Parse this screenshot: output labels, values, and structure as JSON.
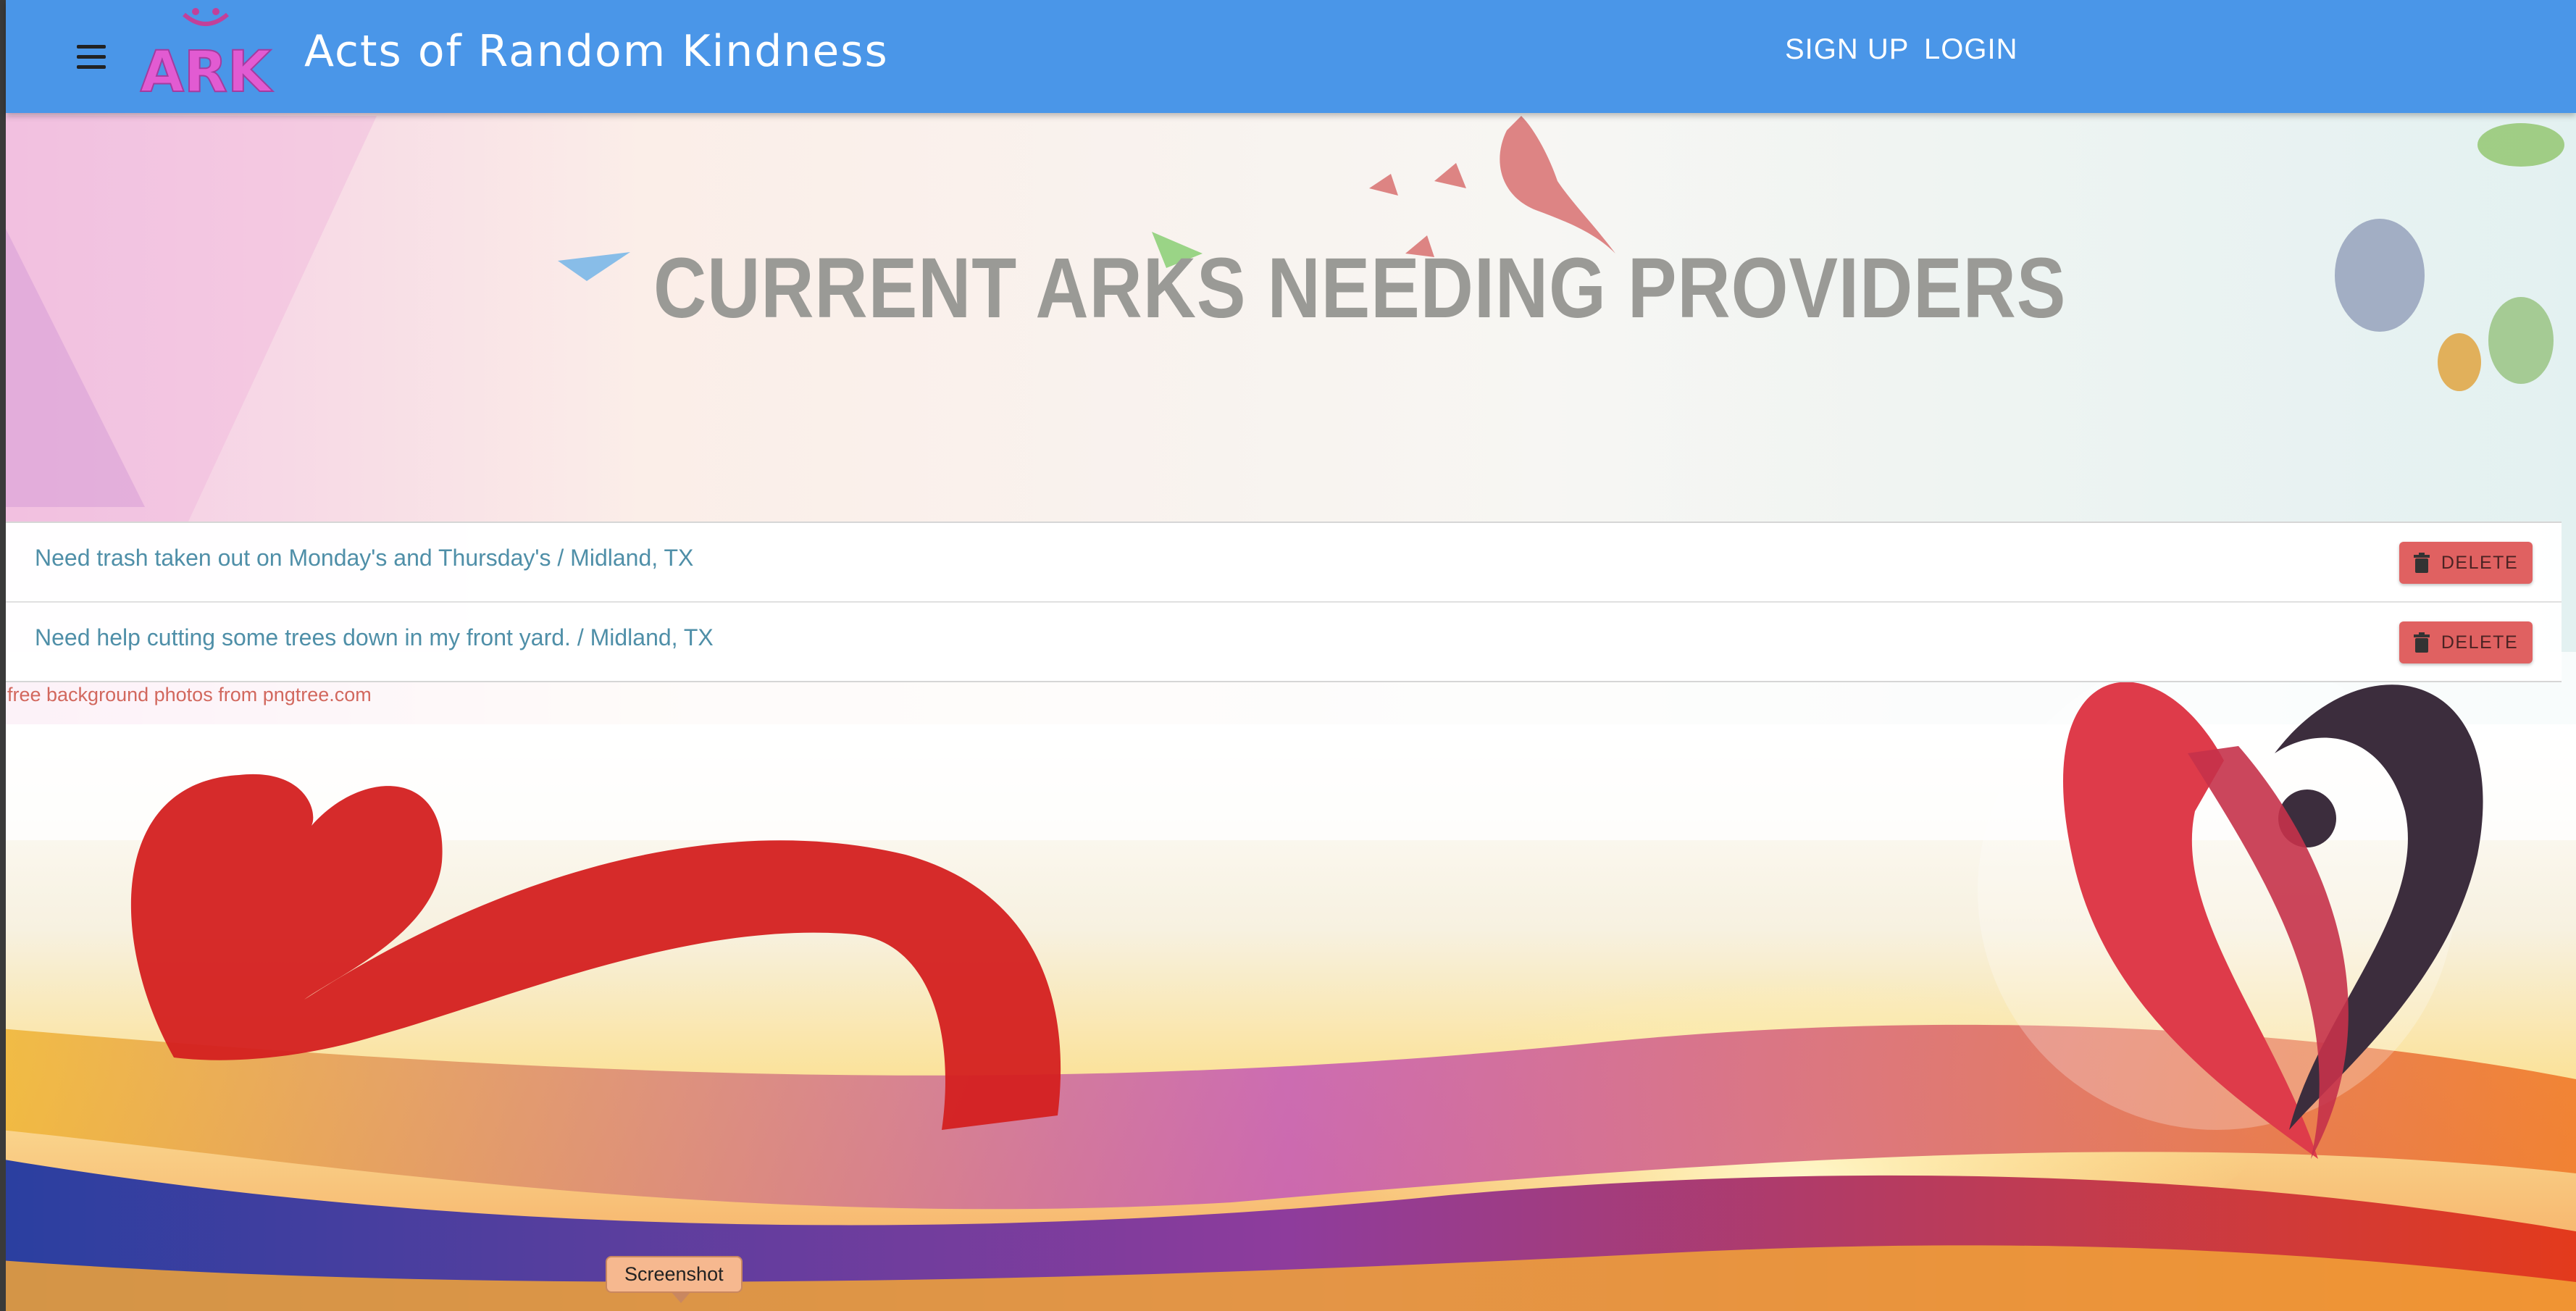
{
  "header": {
    "logo_text": "ARK",
    "title": "Acts of Random Kindness",
    "nav": {
      "signup": "SIGN UP",
      "login": "LOGIN"
    }
  },
  "main": {
    "heading": "CURRENT ARKS NEEDING PROVIDERS",
    "arks": [
      {
        "text": "Need trash taken out on Monday's and Thursday's / Midland, TX",
        "action": "DELETE"
      },
      {
        "text": "Need help cutting some trees down in my front yard. / Midland, TX",
        "action": "DELETE"
      }
    ],
    "credit": "free background photos from pngtree.com"
  },
  "tooltip": {
    "label": "Screenshot"
  },
  "icons": [
    "menu-icon",
    "trash-icon"
  ],
  "colors": {
    "appbar": "#4a96e8",
    "delete_button": "#e06161",
    "item_text": "#4f8fa8",
    "heading": "#9a9a96"
  }
}
